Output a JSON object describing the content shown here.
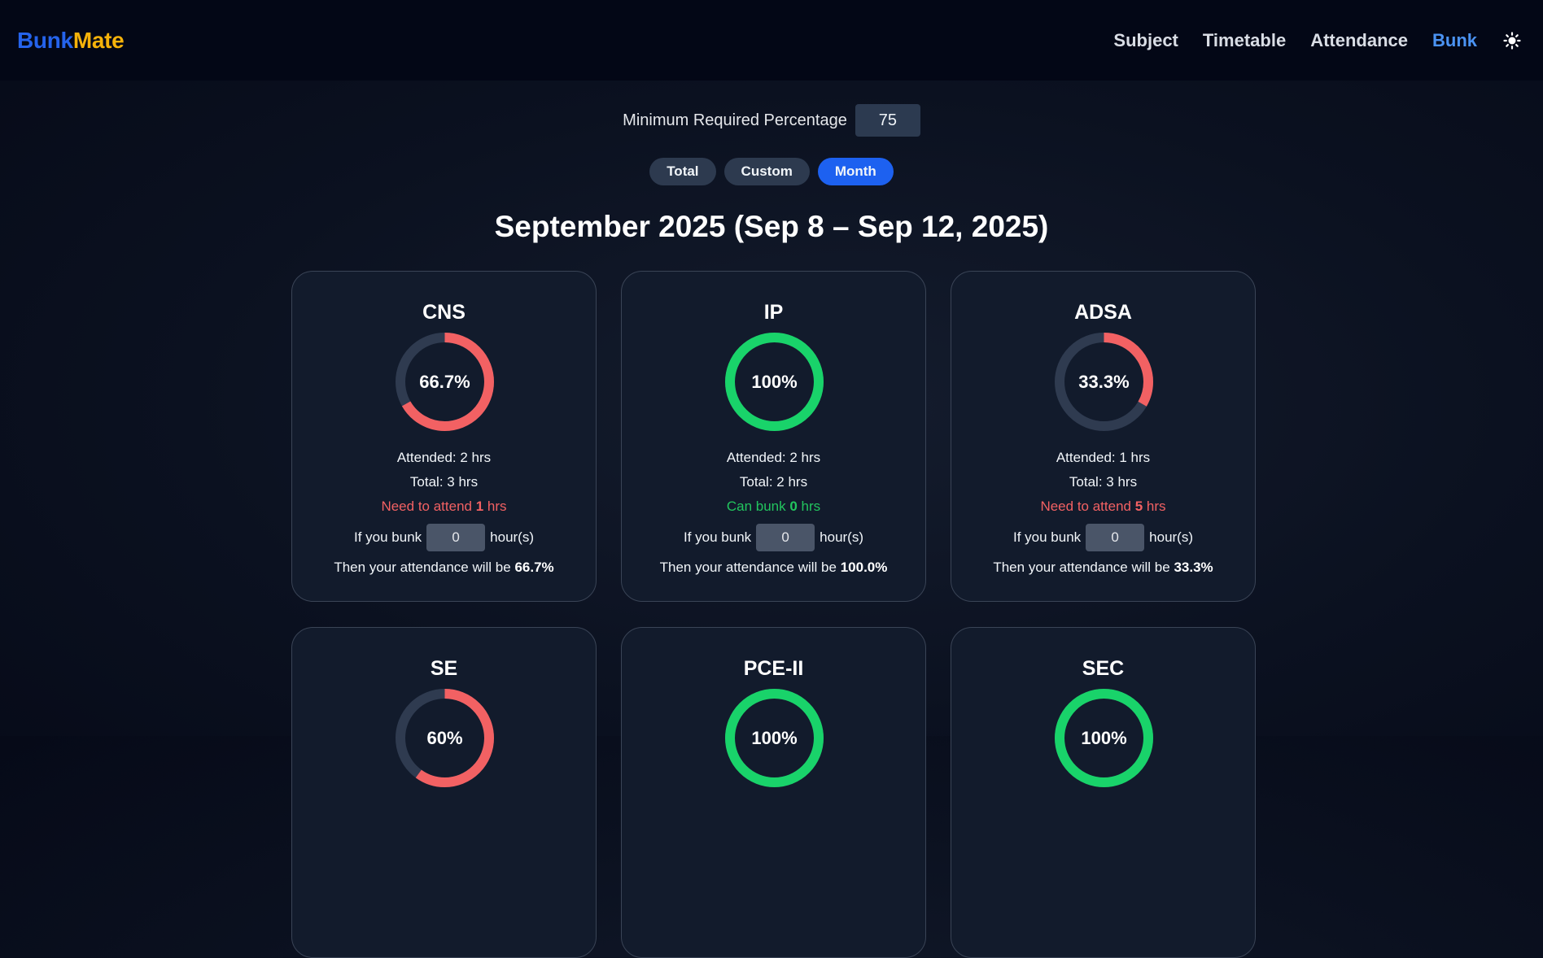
{
  "brand": {
    "part1": "Bunk",
    "part2": "Mate"
  },
  "nav": {
    "items": [
      {
        "label": "Subject",
        "active": false
      },
      {
        "label": "Timetable",
        "active": false
      },
      {
        "label": "Attendance",
        "active": false
      },
      {
        "label": "Bunk",
        "active": true
      }
    ],
    "theme_icon": "sun-icon"
  },
  "controls": {
    "min_label": "Minimum Required Percentage",
    "min_value": "75"
  },
  "tabs": [
    {
      "label": "Total",
      "active": false
    },
    {
      "label": "Custom",
      "active": false
    },
    {
      "label": "Month",
      "active": true
    }
  ],
  "period_title": "September 2025 (Sep 8 – Sep 12, 2025)",
  "colors": {
    "track": "#2f3b50",
    "bad": "#f26163",
    "good": "#19d36a",
    "accent": "#1d61f0"
  },
  "labels": {
    "if_bunk": "If you bunk",
    "hours_unit": "hour(s)",
    "then": "Then your attendance will be"
  },
  "subjects": [
    {
      "name": "CNS",
      "percent": 66.7,
      "percent_label": "66.7%",
      "attended": "Attended: 2 hrs",
      "total": "Total: 3 hrs",
      "status_type": "need",
      "status_pre": "Need to attend ",
      "status_num": "1",
      "status_post": " hrs",
      "bunk_value": "0",
      "result": "66.7%"
    },
    {
      "name": "IP",
      "percent": 100,
      "percent_label": "100%",
      "attended": "Attended: 2 hrs",
      "total": "Total: 2 hrs",
      "status_type": "can",
      "status_pre": "Can bunk ",
      "status_num": "0",
      "status_post": " hrs",
      "bunk_value": "0",
      "result": "100.0%"
    },
    {
      "name": "ADSA",
      "percent": 33.3,
      "percent_label": "33.3%",
      "attended": "Attended: 1 hrs",
      "total": "Total: 3 hrs",
      "status_type": "need",
      "status_pre": "Need to attend ",
      "status_num": "5",
      "status_post": " hrs",
      "bunk_value": "0",
      "result": "33.3%"
    },
    {
      "name": "SE",
      "percent": 60,
      "percent_label": "60%"
    },
    {
      "name": "PCE-II",
      "percent": 100,
      "percent_label": "100%"
    },
    {
      "name": "SEC",
      "percent": 100,
      "percent_label": "100%"
    }
  ]
}
